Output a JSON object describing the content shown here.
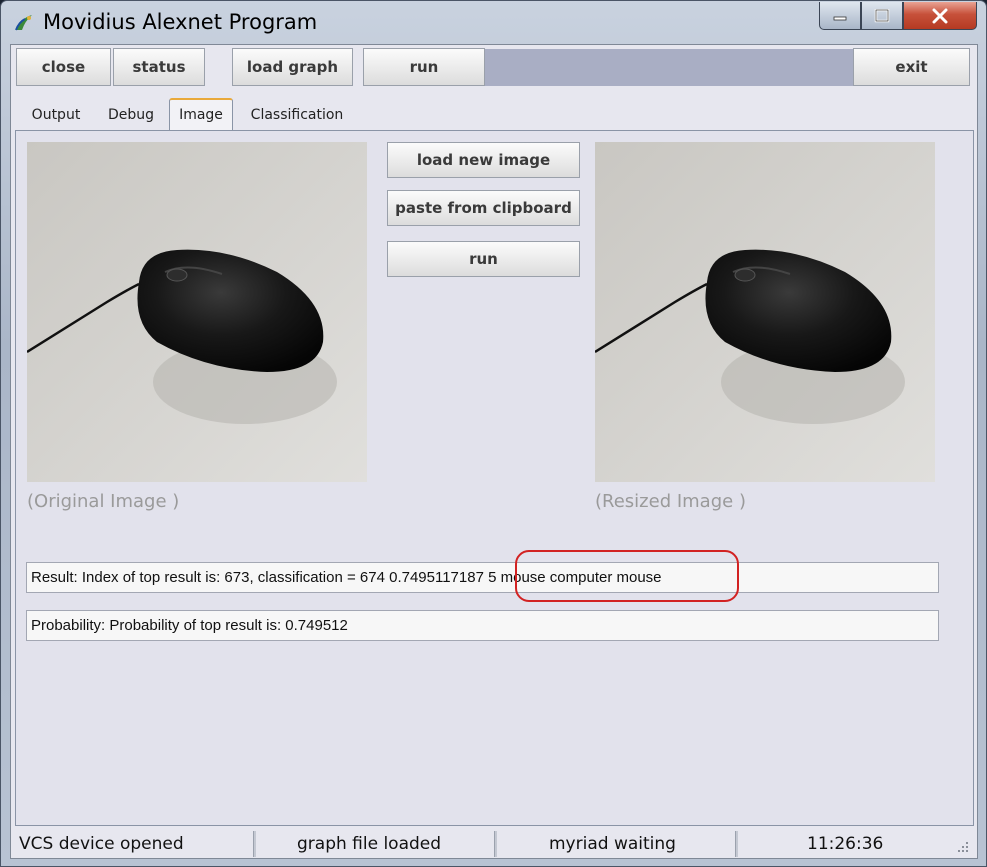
{
  "window": {
    "title": "Movidius Alexnet Program"
  },
  "toolbar": {
    "close_label": "close",
    "status_label": "status",
    "load_graph_label": "load graph",
    "run_label": "run",
    "exit_label": "exit"
  },
  "tabs": [
    {
      "label": "Output"
    },
    {
      "label": "Debug"
    },
    {
      "label": "Image",
      "active": true
    },
    {
      "label": "Classification"
    }
  ],
  "image_panel": {
    "load_new_image_label": "load new image",
    "paste_from_clipboard_label": "paste from clipboard",
    "run_label": "run",
    "original_caption": "(Original Image )",
    "resized_caption": "(Resized Image )"
  },
  "results": {
    "result_text": "Result: Index of top result is: 673, classification =  674 0.7495117187 5 mouse  computer mouse",
    "probability_text": "Probability: Probability of top result is: 0.749512"
  },
  "statusbar": {
    "device": "VCS device opened",
    "graph": "graph file loaded",
    "myriad": "myriad waiting",
    "time": "11:26:36"
  },
  "colors": {
    "highlight": "#d22222",
    "active_tab_accent": "#e9a93a",
    "close_button": "#c7513b"
  }
}
